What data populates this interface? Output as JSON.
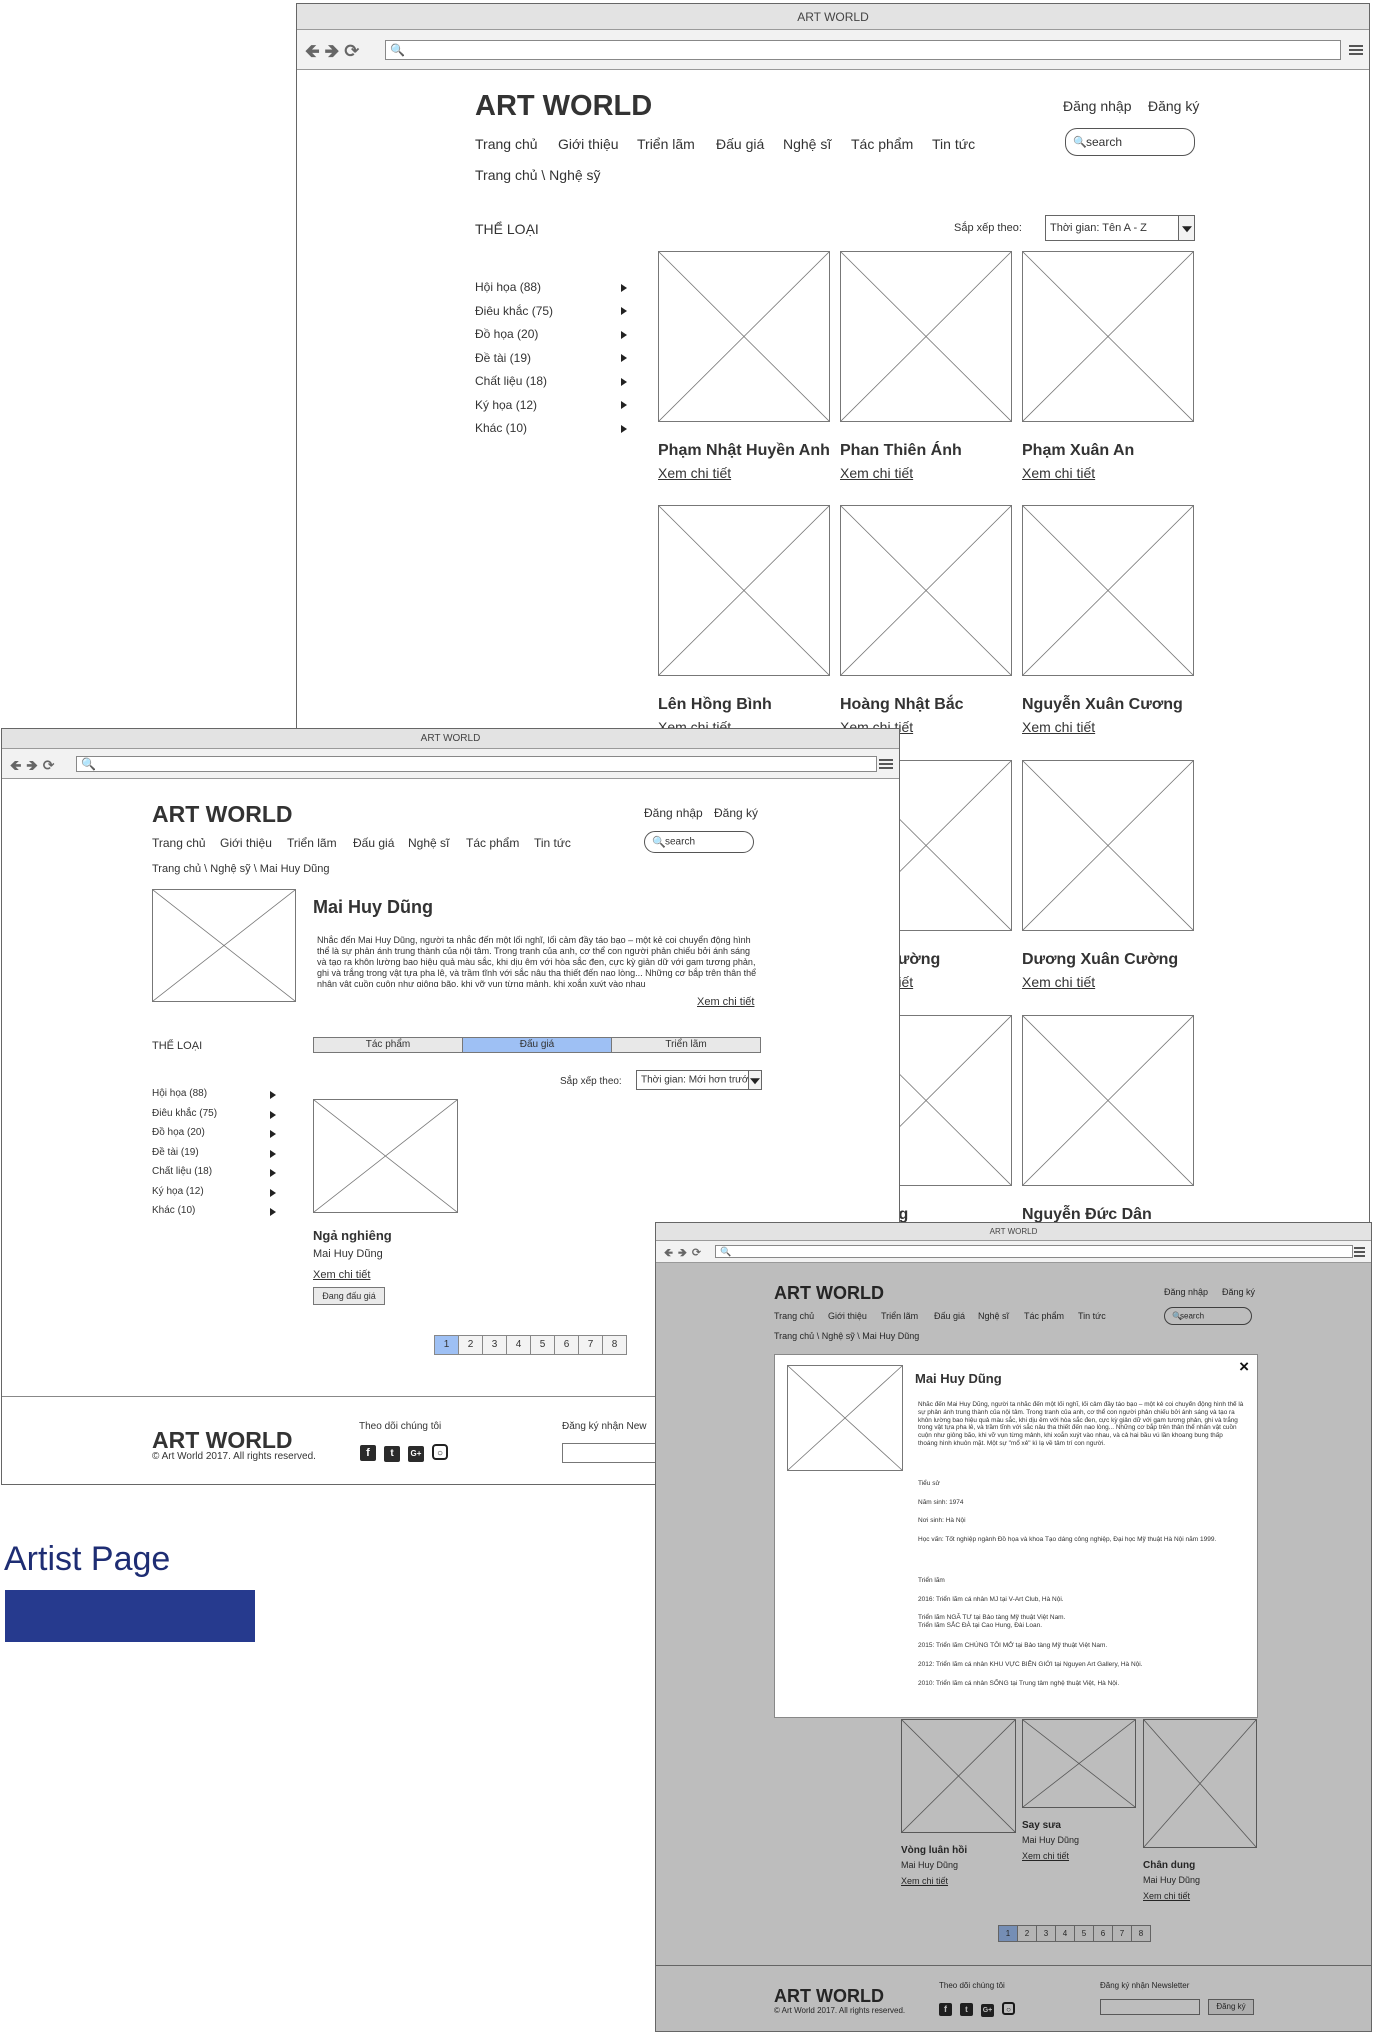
{
  "window_title": "ART WORLD",
  "site": {
    "logo": "ART WORLD",
    "login": "Đăng nhập",
    "register": "Đăng ký",
    "search_placeholder": "search",
    "nav": [
      "Trang chủ",
      "Giới thiệu",
      "Triển lãm",
      "Đấu giá",
      "Nghệ sĩ",
      "Tác phẩm",
      "Tin tức"
    ]
  },
  "artists_list": {
    "breadcrumb": "Trang chủ \\ Nghệ sỹ",
    "category_title": "THỂ LOẠI",
    "categories": [
      "Hội họa (88)",
      "Điêu khắc (75)",
      "Đồ họa (20)",
      "Đề tài (19)",
      "Chất liệu (18)",
      "Ký họa (12)",
      "Khác (10)"
    ],
    "sort_label": "Sắp xếp theo:",
    "sort_value": "Thời gian: Tên A - Z",
    "artists": [
      {
        "name": "Phạm Nhật Huyền Anh",
        "link": "Xem chi tiết"
      },
      {
        "name": "Phan Thiên Ánh",
        "link": "Xem chi tiết"
      },
      {
        "name": "Phạm Xuân An",
        "link": "Xem chi tiết"
      },
      {
        "name": "Lên Hồng Bình",
        "link": "Xem chi tiết"
      },
      {
        "name": "Hoàng Nhật Bắc",
        "link": "Xem chi tiết"
      },
      {
        "name": "Nguyễn Xuân Cương",
        "link": "Xem chi tiết"
      },
      {
        "name": "Mạnh Cường",
        "link": "Xem chi tiết"
      },
      {
        "name": "Dương Xuân Cường",
        "link": "Xem chi tiết"
      },
      {
        "name": "n Dương",
        "link": ""
      },
      {
        "name": "Nguyễn Đức Dân",
        "link": ""
      }
    ]
  },
  "artist_detail": {
    "breadcrumb": "Trang chủ \\ Nghệ sỹ \\ Mai Huy Dũng",
    "name": "Mai Huy Dũng",
    "bio_short": "Nhắc đến Mai Huy Dũng, người ta nhắc đến một lối nghĩ, lối cảm đầy táo bạo – một kẻ coi chuyển động hình thể là sự phản ánh trung thành của nội tâm. Trong tranh của anh, cơ thể con người phản chiếu bởi ánh sáng và tạo ra khôn lường bao hiệu quả màu sắc, khi dịu êm với hòa sắc đen, cực kỳ giản dữ với gam tương phản, ghi và trắng trong vật tựa pha lê, và trầm tĩnh với sắc nâu tha thiết đến nao lòng... Những cơ bắp trên thân thể nhân vật cuồn cuộn như giông bão, khi vỡ vụn từng mảnh, khi xoắn xuýt vào nhau",
    "more_link": "Xem chi tiết",
    "tabs": [
      "Tác phẩm",
      "Đấu giá",
      "Triển lãm"
    ],
    "active_tab": "Đấu giá",
    "sort_value": "Thời gian: Mới hơn trước",
    "artwork": {
      "title": "Ngả nghiêng",
      "artist": "Mai Huy Dũng",
      "link": "Xem chi tiết",
      "button": "Đang đấu giá"
    },
    "pages": [
      "1",
      "2",
      "3",
      "4",
      "5",
      "6",
      "7",
      "8"
    ],
    "current_page": "1"
  },
  "footer": {
    "logo": "ART WORLD",
    "copyright": "© Art World 2017. All rights reserved.",
    "follow": "Theo dõi chúng tôi",
    "newsletter": "Đăng ký nhận Newsletter",
    "newsletter_cut": "Đăng ký nhận New",
    "subscribe": "Đăng ký",
    "social_icons": [
      "facebook-icon",
      "twitter-icon",
      "google-plus-icon",
      "instagram-icon"
    ]
  },
  "modal": {
    "close": "×",
    "name": "Mai Huy Dũng",
    "bio": "Nhắc đến Mai Huy Dũng, người ta nhắc đến một lối nghĩ, lối cảm đầy táo bạo – một kẻ coi chuyển động hình thể là sự phản ánh trung thành của nội tâm. Trong tranh của anh, cơ thể con người phản chiếu bởi ánh sáng và tạo ra khôn lường bao hiệu quả màu sắc, khi dịu êm với hòa sắc đen, cực kỳ giản dữ với gam tương phản, ghi và trắng trong vật tựa pha lê, và trầm tĩnh với sắc nâu tha thiết đến nao lòng... Những cơ bắp trên thân thể nhân vật cuồn cuộn như giông bão, khi vỡ vụn từng mảnh, khi xoắn xuýt vào nhau, và cả hai bầu vú lần khoang bung thấp thoáng hình khuôn mặt. Một sự \"mổ xẻ\" kì lạ về tâm trí con người.",
    "section_bio": "Tiểu sử",
    "birth_year": "Năm sinh: 1974",
    "birthplace": "Nơi sinh: Hà Nội",
    "education": "Học vấn: Tốt nghiệp ngành Đồ họa và khoa Tạo dáng công nghiệp, Đại học Mỹ thuật Hà Nội năm 1999.",
    "section_exhibitions": "Triển lãm",
    "exhibitions": [
      "2016: Triển lãm cá nhân MJ tại V-Art Club, Hà Nội.",
      "Triển lãm NGÃ TƯ tại Bảo tàng Mỹ thuật Việt Nam.",
      "Triển lãm SẮC ĐÀ tại Cao Hung, Đài Loan.",
      "2015: Triển lãm CHÚNG TÔI MỞ tại Bảo tàng Mỹ thuật Việt Nam.",
      "2012: Triển lãm cá nhân KHU VỰC BIÊN GIỚI tại Nguyen Art Gallery, Hà Nội.",
      "2010: Triển lãm cá nhân SỐNG tại Trung tâm nghệ thuật Việt, Hà Nội."
    ],
    "behind_works": [
      {
        "title": "Vòng luân hồi",
        "artist": "Mai Huy Dũng",
        "link": "Xem chi tiết"
      },
      {
        "title": "Say sưa",
        "artist": "Mai Huy Dũng",
        "link": "Xem chi tiết"
      },
      {
        "title": "Chân dung",
        "artist": "Mai Huy Dũng",
        "link": "Xem chi tiết"
      }
    ]
  },
  "annotation": {
    "label": "Artist Page",
    "color": "#263a8e"
  }
}
